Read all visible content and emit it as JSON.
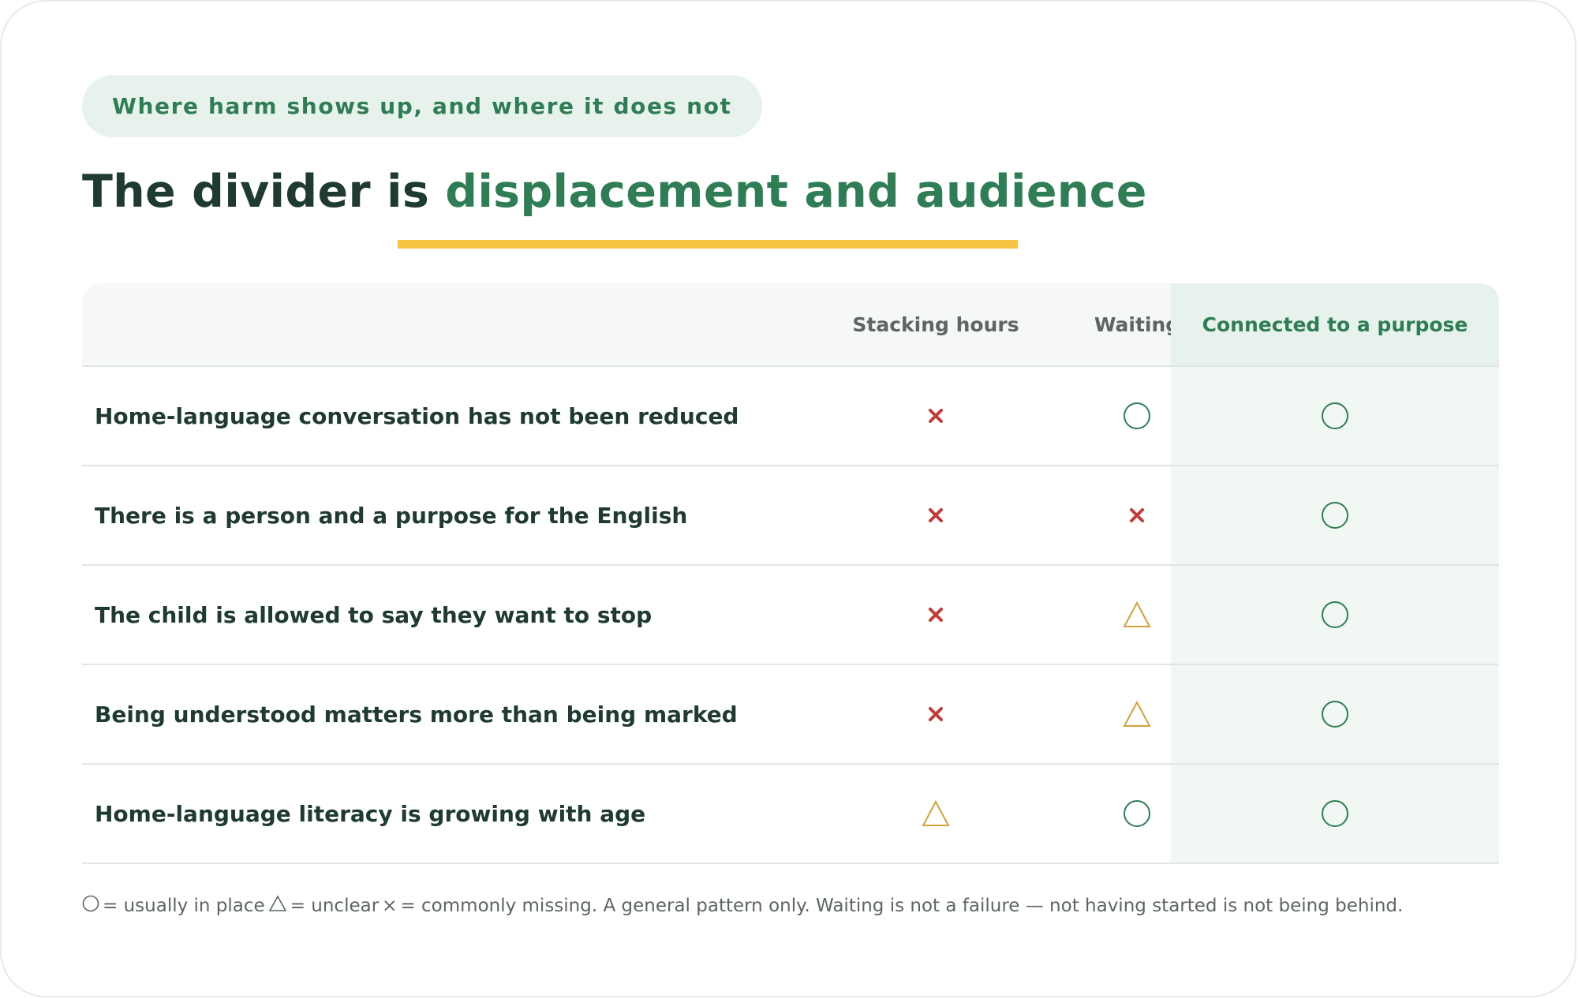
{
  "eyebrow": "Where harm shows up, and where it does not",
  "title": {
    "prefix": "The divider is ",
    "accent": "displacement and audience"
  },
  "colors": {
    "accent": "#2f7d55",
    "underline": "#f6c443",
    "cross": "#c23b35",
    "triangle": "#d4a23a",
    "circle": "#2f7d55"
  },
  "table": {
    "columns": [
      "Stacking hours",
      "Waiting",
      "Connected to a purpose"
    ],
    "rows": [
      {
        "label": "Home-language conversation has not been reduced",
        "cells": [
          "cross",
          "circle",
          "circle"
        ]
      },
      {
        "label": "There is a person and a purpose for the English",
        "cells": [
          "cross",
          "cross",
          "circle"
        ]
      },
      {
        "label": "The child is allowed to say they want to stop",
        "cells": [
          "cross",
          "triangle",
          "circle"
        ]
      },
      {
        "label": "Being understood matters more than being marked",
        "cells": [
          "cross",
          "triangle",
          "circle"
        ]
      },
      {
        "label": "Home-language literacy is growing with age",
        "cells": [
          "triangle",
          "circle",
          "circle"
        ]
      }
    ]
  },
  "footnote": {
    "circle_text": "= usually in place",
    "triangle_text": "= unclear",
    "cross_glyph": "×",
    "cross_text": "= commonly missing. A general pattern only. Waiting is not a failure — not having started is not being behind."
  }
}
